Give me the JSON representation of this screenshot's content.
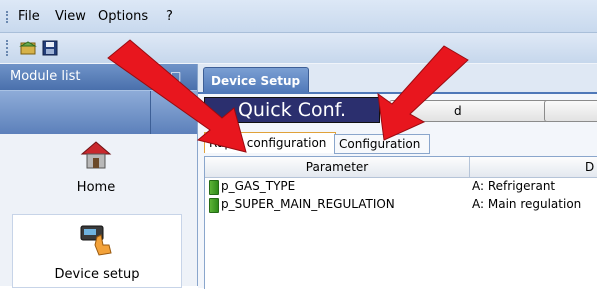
{
  "menubar": {
    "items": [
      "File",
      "View",
      "Options",
      "?"
    ]
  },
  "toolbar": {
    "buttons": [
      "open-icon",
      "save-icon"
    ]
  },
  "module_list": {
    "title": "Module list",
    "pin": "p",
    "items": [
      {
        "label": "Home",
        "icon": "home-icon"
      },
      {
        "label": "Device setup",
        "icon": "device-touch-icon"
      }
    ]
  },
  "document": {
    "tab_label": "Device Setup",
    "quick_conf_label": "Quick Conf.",
    "button_partial_text": "d"
  },
  "subtabs": [
    "Rapid configuration",
    "Configuration"
  ],
  "grid": {
    "columns": [
      "Parameter",
      "D"
    ],
    "rows": [
      {
        "parameter": "p_GAS_TYPE",
        "description": "A: Refrigerant"
      },
      {
        "parameter": "p_SUPER_MAIN_REGULATION",
        "description": "A: Main regulation"
      }
    ]
  },
  "colors": {
    "accent_arrow": "#e8161e",
    "header_blue": "#4f78b8"
  }
}
